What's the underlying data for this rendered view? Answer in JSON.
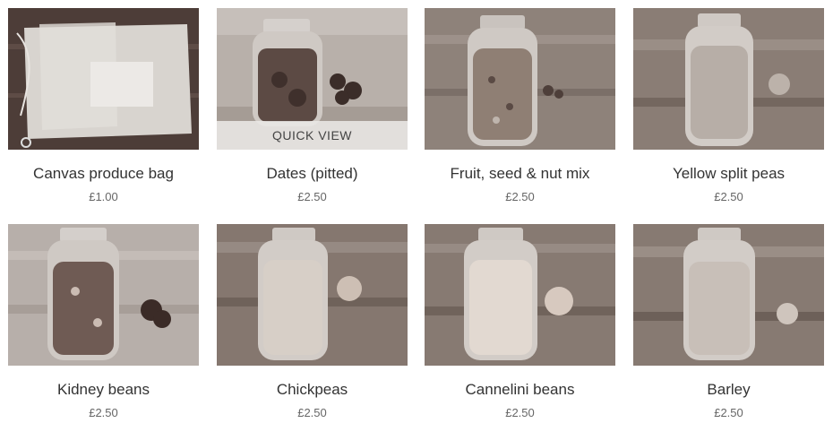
{
  "products": [
    {
      "name": "Canvas produce bag",
      "price": "£1.00",
      "image": "canvas-bag"
    },
    {
      "name": "Dates (pitted)",
      "price": "£2.50",
      "image": "dates-jar",
      "overlay": "QUICK VIEW"
    },
    {
      "name": "Fruit, seed & nut mix",
      "price": "£2.50",
      "image": "fruit-seed-nut-jar"
    },
    {
      "name": "Yellow split peas",
      "price": "£2.50",
      "image": "split-peas-jar"
    },
    {
      "name": "Kidney beans",
      "price": "£2.50",
      "image": "kidney-beans-jar"
    },
    {
      "name": "Chickpeas",
      "price": "£2.50",
      "image": "chickpeas-jar"
    },
    {
      "name": "Cannelini beans",
      "price": "£2.50",
      "image": "cannelini-jar"
    },
    {
      "name": "Barley",
      "price": "£2.50",
      "image": "barley-jar"
    }
  ],
  "colors": {
    "wood_dark": "#5a4a44",
    "wood_light": "#9a8e86",
    "glass": "#c9c3be",
    "quick_view_bg": "#ebe8e6"
  }
}
